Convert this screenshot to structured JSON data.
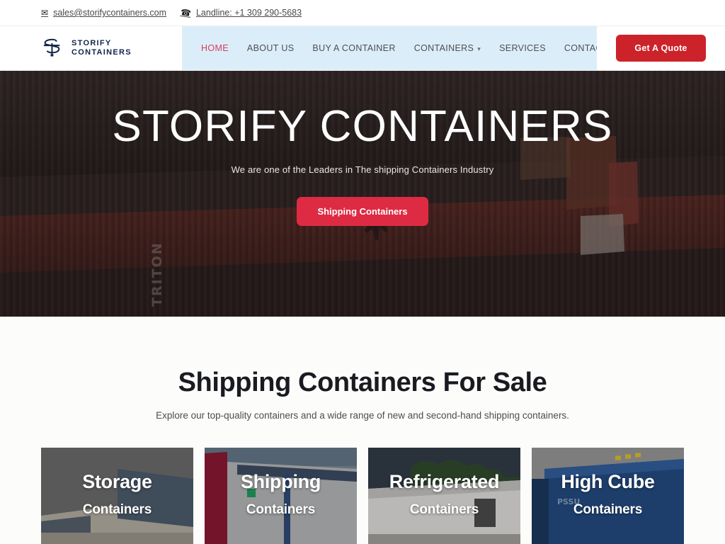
{
  "topbar": {
    "email": "sales@storifycontainers.com",
    "email_icon": "envelope-icon",
    "phone": "Landline: +1 309 290-5683",
    "phone_icon": "phone-icon"
  },
  "header": {
    "logo_line1": "STORIFY",
    "logo_line2": "CONTAINERS",
    "nav": [
      {
        "label": "HOME",
        "active": true,
        "has_dropdown": false
      },
      {
        "label": "ABOUT US",
        "active": false,
        "has_dropdown": false
      },
      {
        "label": "BUY A CONTAINER",
        "active": false,
        "has_dropdown": false
      },
      {
        "label": "CONTAINERS",
        "active": false,
        "has_dropdown": true
      },
      {
        "label": "SERVICES",
        "active": false,
        "has_dropdown": false
      },
      {
        "label": "CONTACT US",
        "active": false,
        "has_dropdown": false
      }
    ],
    "quote_button": "Get A Quote",
    "nav_background": "#dcedfa",
    "active_color": "#d2405a",
    "quote_color": "#cc2229"
  },
  "hero": {
    "title": "STORIFY CONTAINERS",
    "subtitle": "We are one of the Leaders in The shipping Containers Industry",
    "cta": "Shipping Containers",
    "cta_color": "#dd2b44",
    "background_alt": "stacked shipping containers yard with TRITON container"
  },
  "products": {
    "title": "Shipping Containers For Sale",
    "subtitle": "Explore our top-quality containers and a wide range of new and second-hand shipping containers.",
    "cards": [
      {
        "line1": "Storage",
        "line2": "Containers",
        "alt": "gray and blue storage containers"
      },
      {
        "line1": "Shipping",
        "line2": "Containers",
        "alt": "red and blue shipping containers"
      },
      {
        "line1": "Refrigerated",
        "line2": "Containers",
        "alt": "white refrigerated container with trees"
      },
      {
        "line1": "High Cube",
        "line2": "Containers",
        "alt": "blue high cube container"
      }
    ]
  }
}
